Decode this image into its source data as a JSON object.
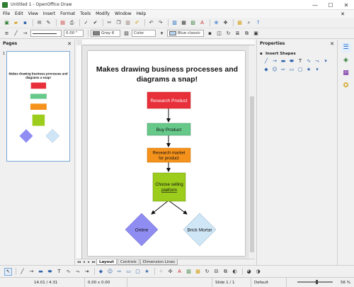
{
  "window": {
    "title": "Untitled 1 - OpenOffice Draw",
    "controls": [
      "—",
      "☐",
      "✕"
    ]
  },
  "menu": [
    "File",
    "Edit",
    "View",
    "Insert",
    "Format",
    "Tools",
    "Modify",
    "Window",
    "Help"
  ],
  "toolbar2": {
    "line_width": "0.00 \"",
    "area_color_name": "Gray 6",
    "color_mode": "Color",
    "fill_style": "Blue classic"
  },
  "pages_panel": {
    "title": "Pages",
    "page_number": "1"
  },
  "document": {
    "heading": "Makes drawing business processes and diagrams a snap!",
    "nodes": [
      {
        "label": "Research Product",
        "color": "#e8303a"
      },
      {
        "label": "Buy Product",
        "color": "#66c98a"
      },
      {
        "label": "Research market for product",
        "color": "#f5921b"
      },
      {
        "label": "Choose selling platform",
        "color": "#9ccc1c"
      },
      {
        "label": "Online",
        "color": "#8f8cf2"
      },
      {
        "label": "Brick Mortar",
        "color": "#cfe6f7"
      }
    ]
  },
  "tabs": {
    "layout": "Layout",
    "controls": "Controls",
    "dimension_lines": "Dimension Lines"
  },
  "properties": {
    "title": "Properties",
    "section": "Insert Shapes"
  },
  "status": {
    "position": "14.01 / 4.31",
    "size": "0.00 x 0.00",
    "slide": "Slide 1 / 1",
    "layout": "Default",
    "zoom": "56 %",
    "zoom_level": 0.56
  }
}
